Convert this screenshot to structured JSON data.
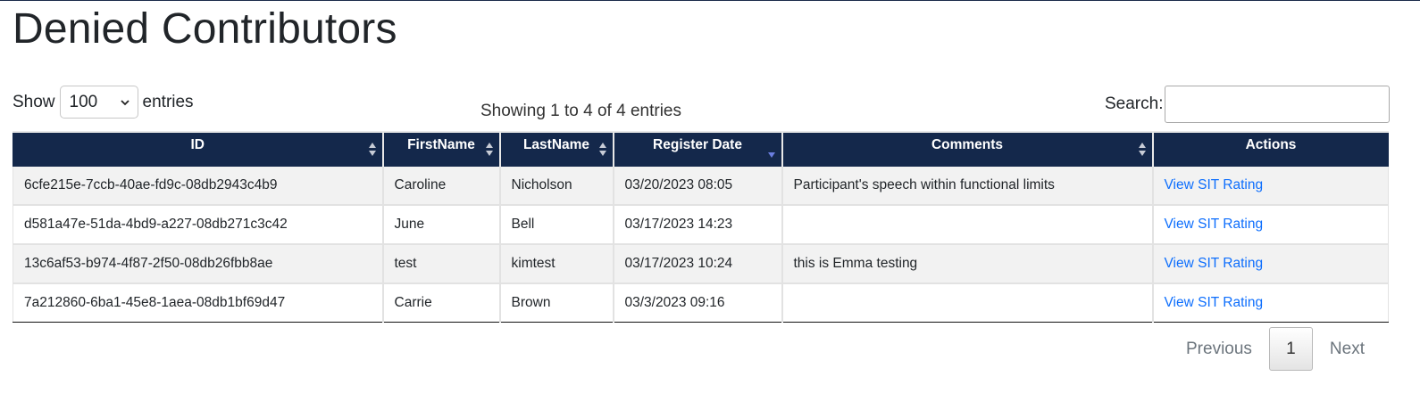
{
  "page": {
    "title": "Denied Contributors"
  },
  "length": {
    "show_label": "Show",
    "selected": "100",
    "entries_label": "entries"
  },
  "info": "Showing 1 to 4 of 4 entries",
  "search": {
    "label": "Search:",
    "value": ""
  },
  "table": {
    "columns": [
      {
        "label": "ID",
        "sort": "both"
      },
      {
        "label": "FirstName",
        "sort": "both"
      },
      {
        "label": "LastName",
        "sort": "both"
      },
      {
        "label": "Register Date",
        "sort": "desc"
      },
      {
        "label": "Comments",
        "sort": "both"
      },
      {
        "label": "Actions",
        "sort": "none"
      }
    ],
    "rows": [
      {
        "id": "6cfe215e-7ccb-40ae-fd9c-08db2943c4b9",
        "first": "Caroline",
        "last": "Nicholson",
        "date": "03/20/2023 08:05",
        "comments": "Participant's speech within functional limits",
        "action": "View SIT Rating"
      },
      {
        "id": "d581a47e-51da-4bd9-a227-08db271c3c42",
        "first": "June",
        "last": "Bell",
        "date": "03/17/2023 14:23",
        "comments": "",
        "action": "View SIT Rating"
      },
      {
        "id": "13c6af53-b974-4f87-2f50-08db26fbb8ae",
        "first": "test",
        "last": "kimtest",
        "date": "03/17/2023 10:24",
        "comments": "this is Emma testing",
        "action": "View SIT Rating"
      },
      {
        "id": "7a212860-6ba1-45e8-1aea-08db1bf69d47",
        "first": "Carrie",
        "last": "Brown",
        "date": "03/3/2023 09:16",
        "comments": "",
        "action": "View SIT Rating"
      }
    ]
  },
  "pagination": {
    "previous": "Previous",
    "current": "1",
    "next": "Next"
  },
  "colors": {
    "header_bg": "#14284b",
    "link": "#0d6efd",
    "row_stripe": "#f2f2f2",
    "sort_active": "#6b7ee0"
  }
}
